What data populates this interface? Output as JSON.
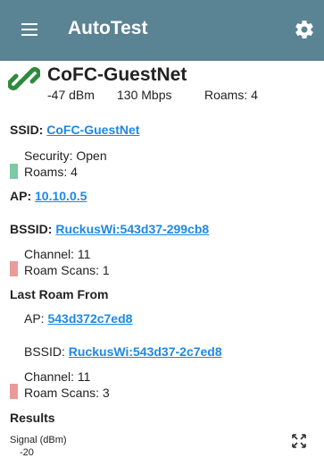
{
  "appbar": {
    "title": "AutoTest"
  },
  "header": {
    "network_name": "CoFC-GuestNet",
    "signal": "-47 dBm",
    "rate": "130 Mbps",
    "roams": "Roams: 4"
  },
  "ssid": {
    "label": "SSID:",
    "value": "CoFC-GuestNet",
    "security": "Security: Open",
    "roams": "Roams: 4"
  },
  "ap": {
    "label": "AP:",
    "value": "10.10.0.5"
  },
  "bssid": {
    "label": "BSSID:",
    "value": "RuckusWi:543d37-299cb8",
    "channel": "Channel: 11",
    "roam_scans": "Roam Scans: 1"
  },
  "last_roam": {
    "heading": "Last Roam From",
    "ap_label": "AP:",
    "ap_value": "543d372c7ed8",
    "bssid_label": "BSSID:",
    "bssid_value": "RuckusWi:543d37-2c7ed8",
    "channel": "Channel: 11",
    "roam_scans": "Roam Scans: 3"
  },
  "results": {
    "heading": "Results",
    "chart_label": "Signal (dBm)",
    "first_tick": "-20"
  },
  "colors": {
    "appbar": "#5a8393",
    "link": "#1e88e5",
    "good": "#7cc9a3",
    "bad": "#e99a99",
    "header_icon": "#2e8b3d"
  }
}
